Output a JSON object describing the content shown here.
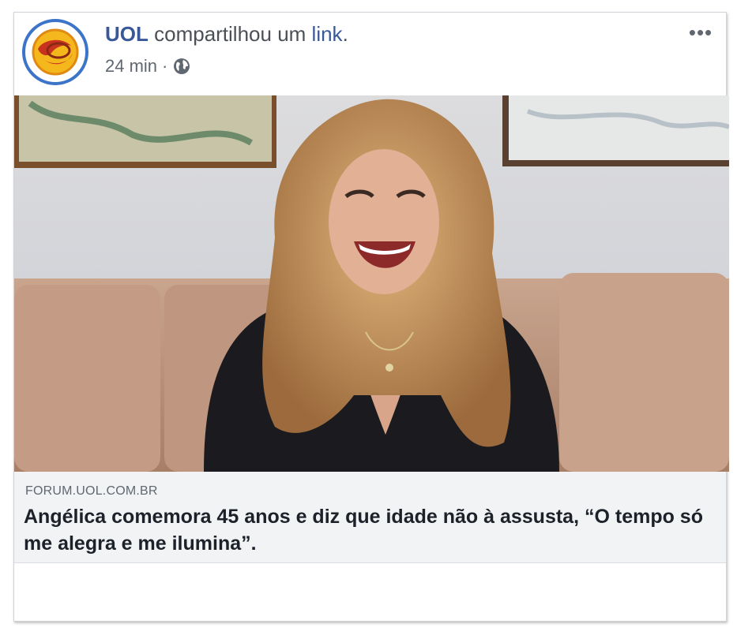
{
  "post": {
    "page_name": "UOL",
    "action_text": " compartilhou um ",
    "link_word": "link",
    "period": ".",
    "time": "24 min",
    "separator": "·",
    "privacy_icon": "globe-icon",
    "more_label": "•••"
  },
  "avatar": {
    "icon": "uol-logo",
    "ring_color": "#3b74c9"
  },
  "photo": {
    "description_icon": "photo"
  },
  "link_preview": {
    "domain": "FORUM.UOL.COM.BR",
    "headline": "Angélica comemora 45 anos e diz que idade não à assusta, “O tempo só me alegra e me ilumina”."
  },
  "colors": {
    "brand_link": "#385898",
    "meta_text": "#616770",
    "preview_bg": "#f2f3f5"
  }
}
